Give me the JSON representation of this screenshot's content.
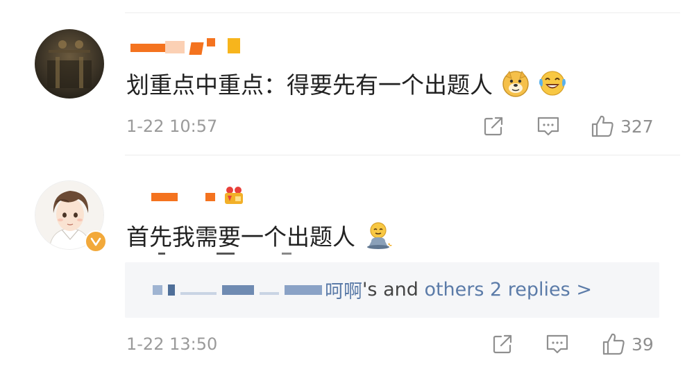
{
  "comments": [
    {
      "text": "划重点中重点：得要先有一个出题人",
      "emojis": [
        "doge-emoji",
        "laugh-cry-emoji"
      ],
      "timestamp": "1-22 10:57",
      "like_count": "327"
    },
    {
      "text": "首先我需要一个出题人",
      "emojis": [
        "meditating-emoji"
      ],
      "timestamp": "1-22 13:50",
      "like_count": "39",
      "replies": {
        "name_suffix": "呵啊",
        "middle": "'s and ",
        "link": "others 2 replies >"
      }
    }
  ],
  "colors": {
    "text": "#222222",
    "meta": "#9a9a9a",
    "link": "#5b7ba8",
    "reply_bg": "#f5f6f8",
    "blur_orange": "#f4731f",
    "blur_yellow": "#f7b51c",
    "verified": "#f2a93b"
  },
  "icons": [
    "share-icon",
    "comment-icon",
    "like-icon",
    "verified-badge-icon"
  ]
}
